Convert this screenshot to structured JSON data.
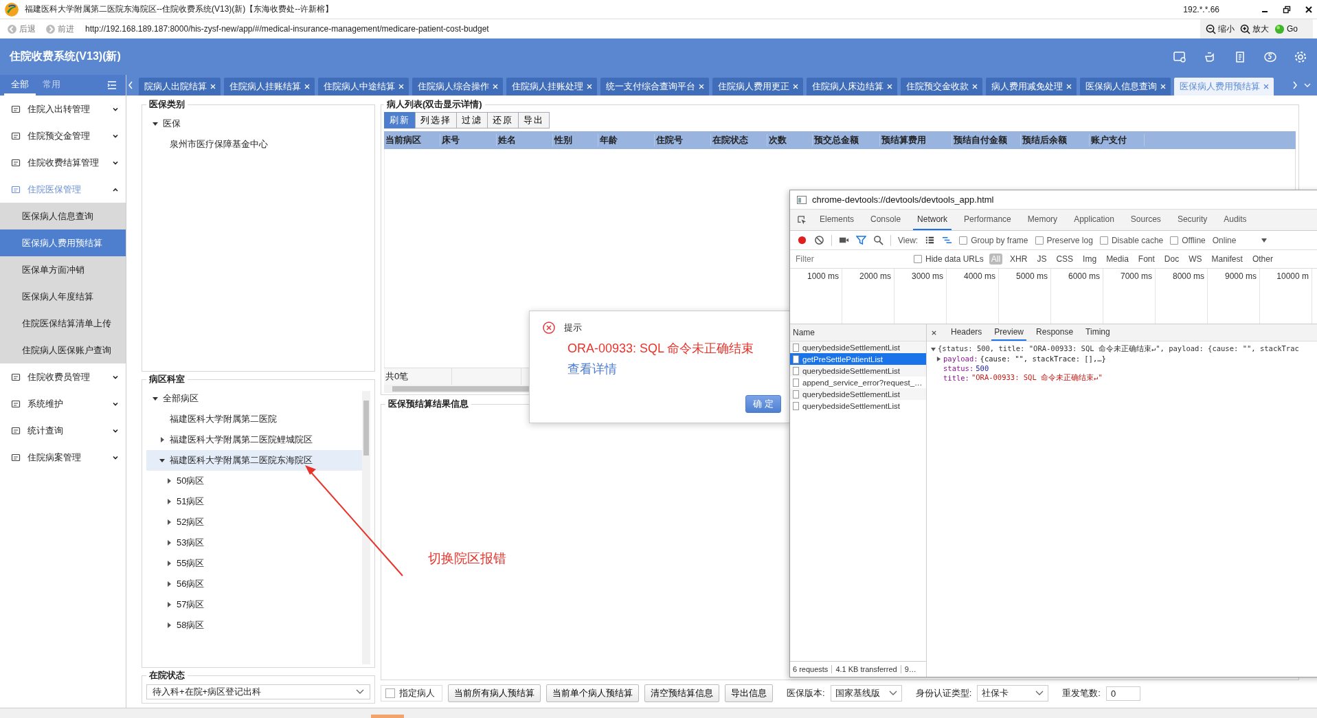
{
  "window": {
    "title": "福建医科大学附属第二医院东海院区--住院收费系统(V13)(新)【东海收费处--许新榕】",
    "ip": "192.*.*.66"
  },
  "browser": {
    "back": "后退",
    "forward": "前进",
    "url": "http://192.168.189.187:8000/his-zysf-new/app/#/medical-insurance-management/medicare-patient-cost-budget",
    "zoom_out": "缩小",
    "zoom_in": "放大",
    "go": "Go"
  },
  "app": {
    "title": "住院收费系统(V13)(新)"
  },
  "sidebar": {
    "tabs": [
      {
        "label": "全部",
        "selected": true
      },
      {
        "label": "常用",
        "selected": false
      }
    ],
    "items": [
      {
        "label": "住院入出转管理",
        "expanded": false
      },
      {
        "label": "住院预交金管理",
        "expanded": false
      },
      {
        "label": "住院收费结算管理",
        "expanded": false
      },
      {
        "label": "住院医保管理",
        "expanded": true,
        "children": [
          {
            "label": "医保病人信息查询",
            "selected": false
          },
          {
            "label": "医保病人费用预结算",
            "selected": true
          },
          {
            "label": "医保单方面冲销",
            "selected": false
          },
          {
            "label": "医保病人年度结算",
            "selected": false
          },
          {
            "label": "住院医保结算清单上传",
            "selected": false
          },
          {
            "label": "住院病人医保账户查询",
            "selected": false
          }
        ]
      },
      {
        "label": "住院收费员管理",
        "expanded": false
      },
      {
        "label": "系统维护",
        "expanded": false
      },
      {
        "label": "统计查询",
        "expanded": false
      },
      {
        "label": "住院病案管理",
        "expanded": false
      }
    ]
  },
  "tabs": [
    {
      "label": "院病人出院结算",
      "selected": false
    },
    {
      "label": "住院病人挂账结算",
      "selected": false
    },
    {
      "label": "住院病人中途结算",
      "selected": false
    },
    {
      "label": "住院病人综合操作",
      "selected": false
    },
    {
      "label": "住院病人挂账处理",
      "selected": false
    },
    {
      "label": "统一支付综合查询平台",
      "selected": false
    },
    {
      "label": "住院病人费用更正",
      "selected": false
    },
    {
      "label": "住院病人床边结算",
      "selected": false
    },
    {
      "label": "住院预交金收款",
      "selected": false
    },
    {
      "label": "病人费用减免处理",
      "selected": false
    },
    {
      "label": "医保病人信息查询",
      "selected": false
    },
    {
      "label": "医保病人费用预结算",
      "selected": true
    }
  ],
  "insurance_type": {
    "title": "医保类别",
    "tree": [
      {
        "label": "医保",
        "expanded": true,
        "children": [
          {
            "label": "泉州市医疗保障基金中心"
          }
        ]
      }
    ]
  },
  "ward": {
    "title": "病区科室",
    "tree": [
      {
        "label": "全部病区",
        "expanded": true,
        "selected": false,
        "children": [
          {
            "label": "福建医科大学附属第二医院",
            "selected": false
          },
          {
            "label": "福建医科大学附属第二医院鲤城院区",
            "expanded": false,
            "selected": false
          },
          {
            "label": "福建医科大学附属第二医院东海院区",
            "expanded": true,
            "selected": true,
            "children": [
              {
                "label": "50病区",
                "expanded": false,
                "selected": false
              },
              {
                "label": "51病区",
                "expanded": false,
                "selected": false
              },
              {
                "label": "52病区",
                "expanded": false,
                "selected": false
              },
              {
                "label": "53病区",
                "expanded": false,
                "selected": false
              },
              {
                "label": "55病区",
                "expanded": false,
                "selected": false
              },
              {
                "label": "56病区",
                "expanded": false,
                "selected": false
              },
              {
                "label": "57病区",
                "expanded": false,
                "selected": false
              },
              {
                "label": "58病区",
                "expanded": false,
                "selected": false
              }
            ]
          }
        ]
      }
    ]
  },
  "status": {
    "title": "在院状态",
    "value": "待入科+在院+病区登记出科"
  },
  "patient_list": {
    "title": "病人列表(双击显示详情)",
    "toolbar": [
      {
        "label": "刷新",
        "selected": true
      },
      {
        "label": "列选择",
        "selected": false
      },
      {
        "label": "过滤",
        "selected": false
      },
      {
        "label": "还原",
        "selected": false
      },
      {
        "label": "导出",
        "selected": false
      }
    ],
    "columns": [
      "当前病区",
      "床号",
      "姓名",
      "性别",
      "年龄",
      "住院号",
      "在院状态",
      "次数",
      "预交总金额",
      "预结算费用",
      "预结自付金额",
      "预结后余额",
      "账户支付"
    ],
    "footer": "共0笔"
  },
  "result": {
    "title": "医保预结算结果信息"
  },
  "bottom_bar": {
    "checkbox": {
      "label": "指定病人",
      "checked": false
    },
    "buttons": [
      "当前所有病人预结算",
      "当前单个病人预结算",
      "清空预结算信息",
      "导出信息"
    ],
    "fields": [
      {
        "label": "医保版本:",
        "value": "国家基线版",
        "kind": "select"
      },
      {
        "label": "身份认证类型:",
        "value": "社保卡",
        "kind": "select"
      },
      {
        "label": "重发笔数:",
        "value": "0",
        "kind": "input"
      }
    ]
  },
  "dialog": {
    "title": "提示",
    "message": "ORA-00933: SQL 命令未正确结束",
    "link": "查看详情",
    "button": "确 定"
  },
  "annotation": {
    "text": "切换院区报错"
  },
  "devtools": {
    "title": "chrome-devtools://devtools/devtools_app.html",
    "tabs": [
      {
        "label": "Elements",
        "selected": false
      },
      {
        "label": "Console",
        "selected": false
      },
      {
        "label": "Network",
        "selected": true
      },
      {
        "label": "Performance",
        "selected": false
      },
      {
        "label": "Memory",
        "selected": false
      },
      {
        "label": "Application",
        "selected": false
      },
      {
        "label": "Sources",
        "selected": false
      },
      {
        "label": "Security",
        "selected": false
      },
      {
        "label": "Audits",
        "selected": false
      }
    ],
    "view_label": "View:",
    "options": [
      {
        "label": "Group by frame",
        "checked": false
      },
      {
        "label": "Preserve log",
        "checked": false
      },
      {
        "label": "Disable cache",
        "checked": false
      },
      {
        "label": "Offline",
        "checked": false
      }
    ],
    "throttle": "Online",
    "filter_placeholder": "Filter",
    "hide_data_urls": {
      "label": "Hide data URLs",
      "checked": false
    },
    "types": [
      {
        "label": "All",
        "selected": true
      },
      {
        "label": "XHR",
        "selected": false
      },
      {
        "label": "JS",
        "selected": false
      },
      {
        "label": "CSS",
        "selected": false
      },
      {
        "label": "Img",
        "selected": false
      },
      {
        "label": "Media",
        "selected": false
      },
      {
        "label": "Font",
        "selected": false
      },
      {
        "label": "Doc",
        "selected": false
      },
      {
        "label": "WS",
        "selected": false
      },
      {
        "label": "Manifest",
        "selected": false
      },
      {
        "label": "Other",
        "selected": false
      }
    ],
    "ticks": [
      "1000 ms",
      "2000 ms",
      "3000 ms",
      "4000 ms",
      "5000 ms",
      "6000 ms",
      "7000 ms",
      "8000 ms",
      "9000 ms",
      "10000 m"
    ],
    "name_header": "Name",
    "requests": [
      {
        "name": "querybedsideSettlementList",
        "selected": false
      },
      {
        "name": "getPreSettlePatientList",
        "selected": true
      },
      {
        "name": "querybedsideSettlementList",
        "selected": false
      },
      {
        "name": "append_service_error?request_…",
        "selected": false
      },
      {
        "name": "querybedsideSettlementList",
        "selected": false
      },
      {
        "name": "querybedsideSettlementList",
        "selected": false
      }
    ],
    "detail_tabs": [
      {
        "label": "Headers",
        "selected": false
      },
      {
        "label": "Preview",
        "selected": true
      },
      {
        "label": "Response",
        "selected": false
      },
      {
        "label": "Timing",
        "selected": false
      }
    ],
    "preview": [
      {
        "kind": "summary",
        "expanded": true,
        "text": "{status: 500, title: \"ORA-00933: SQL 命令未正确结束↵\", payload: {cause: \"\", stackTrac"
      },
      {
        "kind": "property",
        "expanded": false,
        "key": "payload:",
        "value": "{cause: \"\", stackTrace: [],…}",
        "color": "#222222"
      },
      {
        "kind": "property",
        "key": "status:",
        "value": "500",
        "color": "#1a1aa6"
      },
      {
        "kind": "property",
        "key": "title:",
        "value": "\"ORA-00933: SQL 命令未正确结束↵\"",
        "color": "#c41a16"
      }
    ],
    "summary": [
      "6 requests",
      "4.1 KB transferred",
      "9…"
    ]
  }
}
